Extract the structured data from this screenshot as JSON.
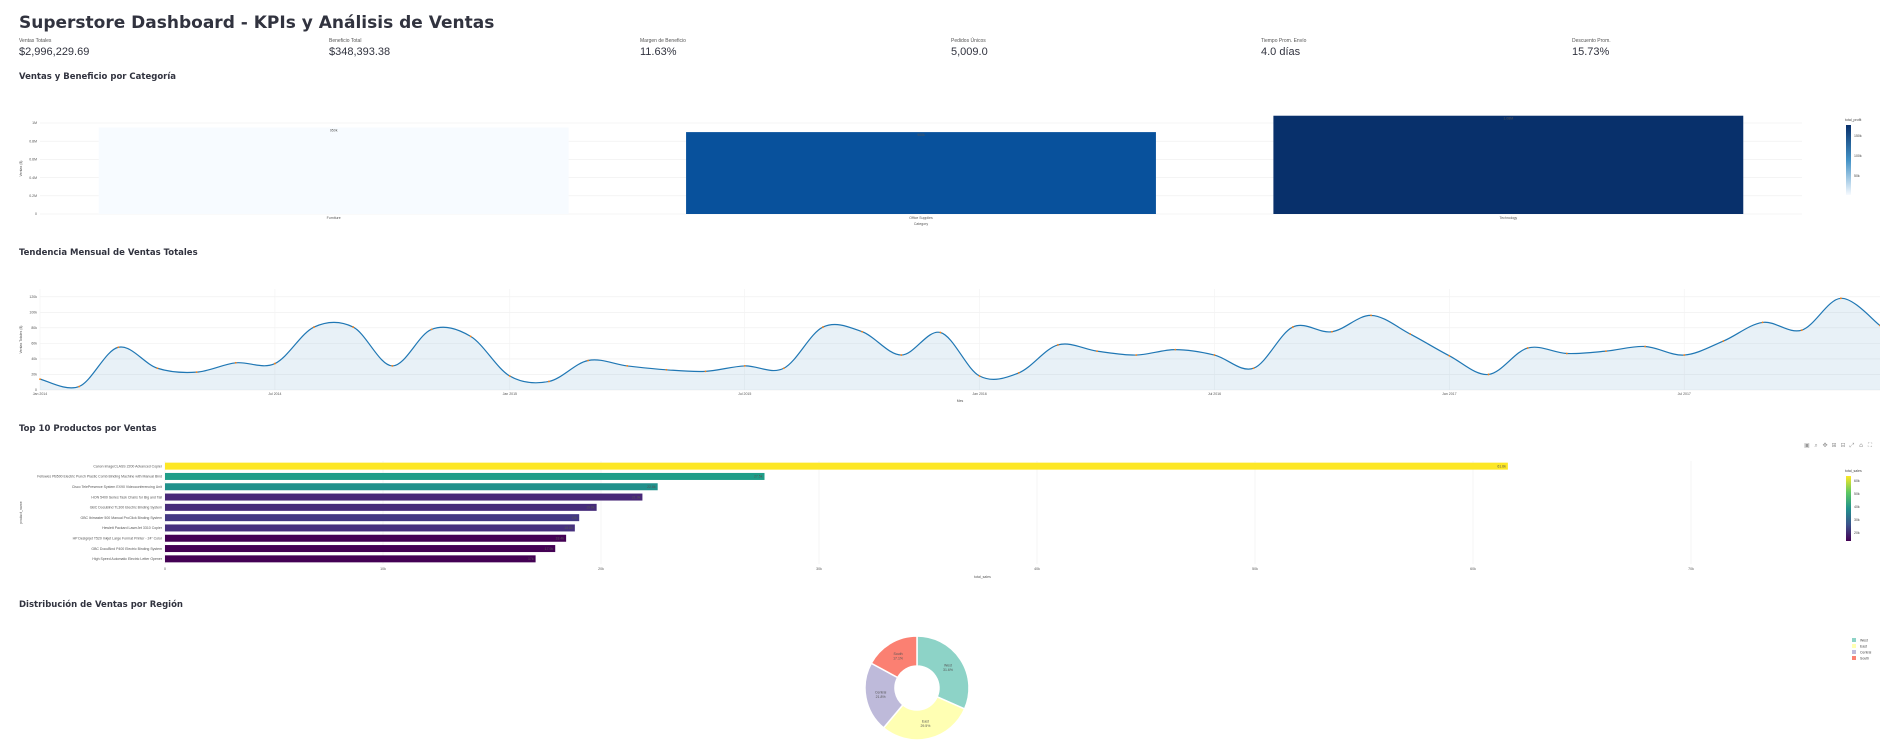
{
  "page": {
    "title": "Superstore Dashboard - KPIs y Análisis de Ventas"
  },
  "kpis": [
    {
      "label": "Ventas Totales",
      "value": "$2,996,229.69"
    },
    {
      "label": "Beneficio Total",
      "value": "$348,393.38"
    },
    {
      "label": "Margen de Beneficio",
      "value": "11.63%"
    },
    {
      "label": "Pedidos Únicos",
      "value": "5,009.0"
    },
    {
      "label": "Tiempo Prom. Envío",
      "value": "4.0 días"
    },
    {
      "label": "Descuento Prom.",
      "value": "15.73%"
    }
  ],
  "sections": {
    "category": "Ventas y Beneficio por Categoría",
    "trend": "Tendencia Mensual de Ventas Totales",
    "top10": "Top 10 Productos por Ventas",
    "region": "Distribución de Ventas por Región"
  },
  "chart_data": [
    {
      "type": "bar",
      "id": "category",
      "categories": [
        "Furniture",
        "Office Supplies",
        "Technology"
      ],
      "values": [
        950000,
        900000,
        1080000
      ],
      "bar_labels": [
        "950k",
        "900k",
        "1.08M"
      ],
      "colors": [
        "#f7fbff",
        "#08519c",
        "#08306b"
      ],
      "xlabel": "Category",
      "ylabel": "Ventas ($)",
      "ylim": [
        0,
        1000000
      ],
      "yticks": [
        0,
        200000,
        400000,
        600000,
        800000,
        1000000
      ],
      "ytick_labels": [
        "0",
        "0.2M",
        "0.4M",
        "0.6M",
        "0.8M",
        "1M"
      ],
      "colorbar": {
        "title": "total_profit",
        "tick_labels": [
          "150k",
          "100k",
          "50k"
        ]
      }
    },
    {
      "type": "area",
      "id": "trend",
      "x": [
        "2014-01",
        "2014-02",
        "2014-03",
        "2014-04",
        "2014-05",
        "2014-06",
        "2014-07",
        "2014-08",
        "2014-09",
        "2014-10",
        "2014-11",
        "2014-12",
        "2015-01",
        "2015-02",
        "2015-03",
        "2015-04",
        "2015-05",
        "2015-06",
        "2015-07",
        "2015-08",
        "2015-09",
        "2015-10",
        "2015-11",
        "2015-12",
        "2016-01",
        "2016-02",
        "2016-03",
        "2016-04",
        "2016-05",
        "2016-06",
        "2016-07",
        "2016-08",
        "2016-09",
        "2016-10",
        "2016-11",
        "2016-12",
        "2017-01",
        "2017-02",
        "2017-03",
        "2017-04",
        "2017-05",
        "2017-06",
        "2017-07",
        "2017-08",
        "2017-09",
        "2017-10",
        "2017-11",
        "2017-12"
      ],
      "values": [
        14000,
        4500,
        55000,
        28000,
        23000,
        35000,
        34000,
        81000,
        81000,
        31000,
        78000,
        69000,
        18000,
        11000,
        38000,
        31000,
        26000,
        24000,
        31000,
        28000,
        81000,
        75000,
        45000,
        74000,
        18000,
        22000,
        58000,
        50000,
        45000,
        52000,
        45000,
        28000,
        81000,
        75000,
        96000,
        72000,
        44000,
        20000,
        54000,
        47000,
        50000,
        56000,
        45000,
        63000,
        87000,
        77000,
        118000,
        83000
      ],
      "xlabel": "Mes",
      "ylabel": "Ventas Totales ($)",
      "ylim": [
        0,
        130000
      ],
      "yticks": [
        0,
        20000,
        40000,
        60000,
        80000,
        100000,
        120000
      ],
      "ytick_labels": [
        "0",
        "20k",
        "40k",
        "60k",
        "80k",
        "100k",
        "120k"
      ],
      "xtick_labels": [
        "Jan 2014",
        "Jul 2014",
        "Jan 2015",
        "Jul 2015",
        "Jan 2016",
        "Jul 2016",
        "Jan 2017",
        "Jul 2017"
      ],
      "line_color": "#1f77b4",
      "marker_color": "#ff7f0e"
    },
    {
      "type": "bar",
      "orientation": "h",
      "id": "top10",
      "categories": [
        "Canon imageCLASS 2200 Advanced Copier",
        "Fellowes PB500 Electric Punch Plastic Comb Binding Machine with Manual Bind",
        "Cisco TelePresence System EX90 Videoconferencing Unit",
        "HON 5400 Series Task Chairs for Big and Tall",
        "GBC DocuBind TL300 Electric Binding System",
        "GBC Ibimaster 500 Manual ProClick Binding System",
        "Hewlett Packard LaserJet 3310 Copier",
        "HP Designjet T520 Inkjet Large Format Printer - 24\" Color",
        "GBC DocuBind P400 Electric Binding System",
        "High Speed Automatic Electric Letter Opener"
      ],
      "values": [
        61600,
        27500,
        22600,
        21900,
        19800,
        19000,
        18800,
        18400,
        17900,
        17000
      ],
      "bar_labels": [
        "61.6k",
        "27.5k",
        "22.6k",
        "21.9k",
        "19.8k",
        "19k",
        "18.8k",
        "18.4k",
        "17.9k",
        "17k"
      ],
      "colors": [
        "#fde725",
        "#1f9e89",
        "#21918c",
        "#482878",
        "#472c7a",
        "#443983",
        "#46307e",
        "#440154",
        "#440154",
        "#440154"
      ],
      "xlabel": "total_sales",
      "ylabel": "product_name",
      "xlim": [
        0,
        75000
      ],
      "xticks": [
        0,
        10000,
        20000,
        30000,
        40000,
        50000,
        60000,
        70000
      ],
      "xtick_labels": [
        "0",
        "10k",
        "20k",
        "30k",
        "40k",
        "50k",
        "60k",
        "70k"
      ],
      "colorbar": {
        "title": "total_sales",
        "tick_labels": [
          "60k",
          "50k",
          "40k",
          "30k",
          "20k"
        ]
      }
    },
    {
      "type": "pie",
      "id": "region",
      "hole": true,
      "labels": [
        "West",
        "East",
        "Central",
        "South"
      ],
      "values": [
        31.6,
        29.5,
        21.8,
        17.1
      ],
      "slice_labels": [
        "West\n31.6%",
        "East\n29.5%",
        "Central\n21.8%",
        "South\n17.1%"
      ],
      "colors": [
        "#8dd3c7",
        "#ffffb3",
        "#bebada",
        "#fb8072"
      ],
      "legend_position": "top-right"
    }
  ],
  "toolbar": {
    "icons": [
      "camera-icon",
      "zoom-icon",
      "pan-icon",
      "zoom-in-icon",
      "zoom-out-icon",
      "autoscale-icon",
      "reset-axes-icon",
      "fullscreen-icon"
    ],
    "glyphs": [
      "▣",
      "⌕",
      "✥",
      "⊞",
      "⊟",
      "⤢",
      "⌂",
      "⛶"
    ]
  }
}
